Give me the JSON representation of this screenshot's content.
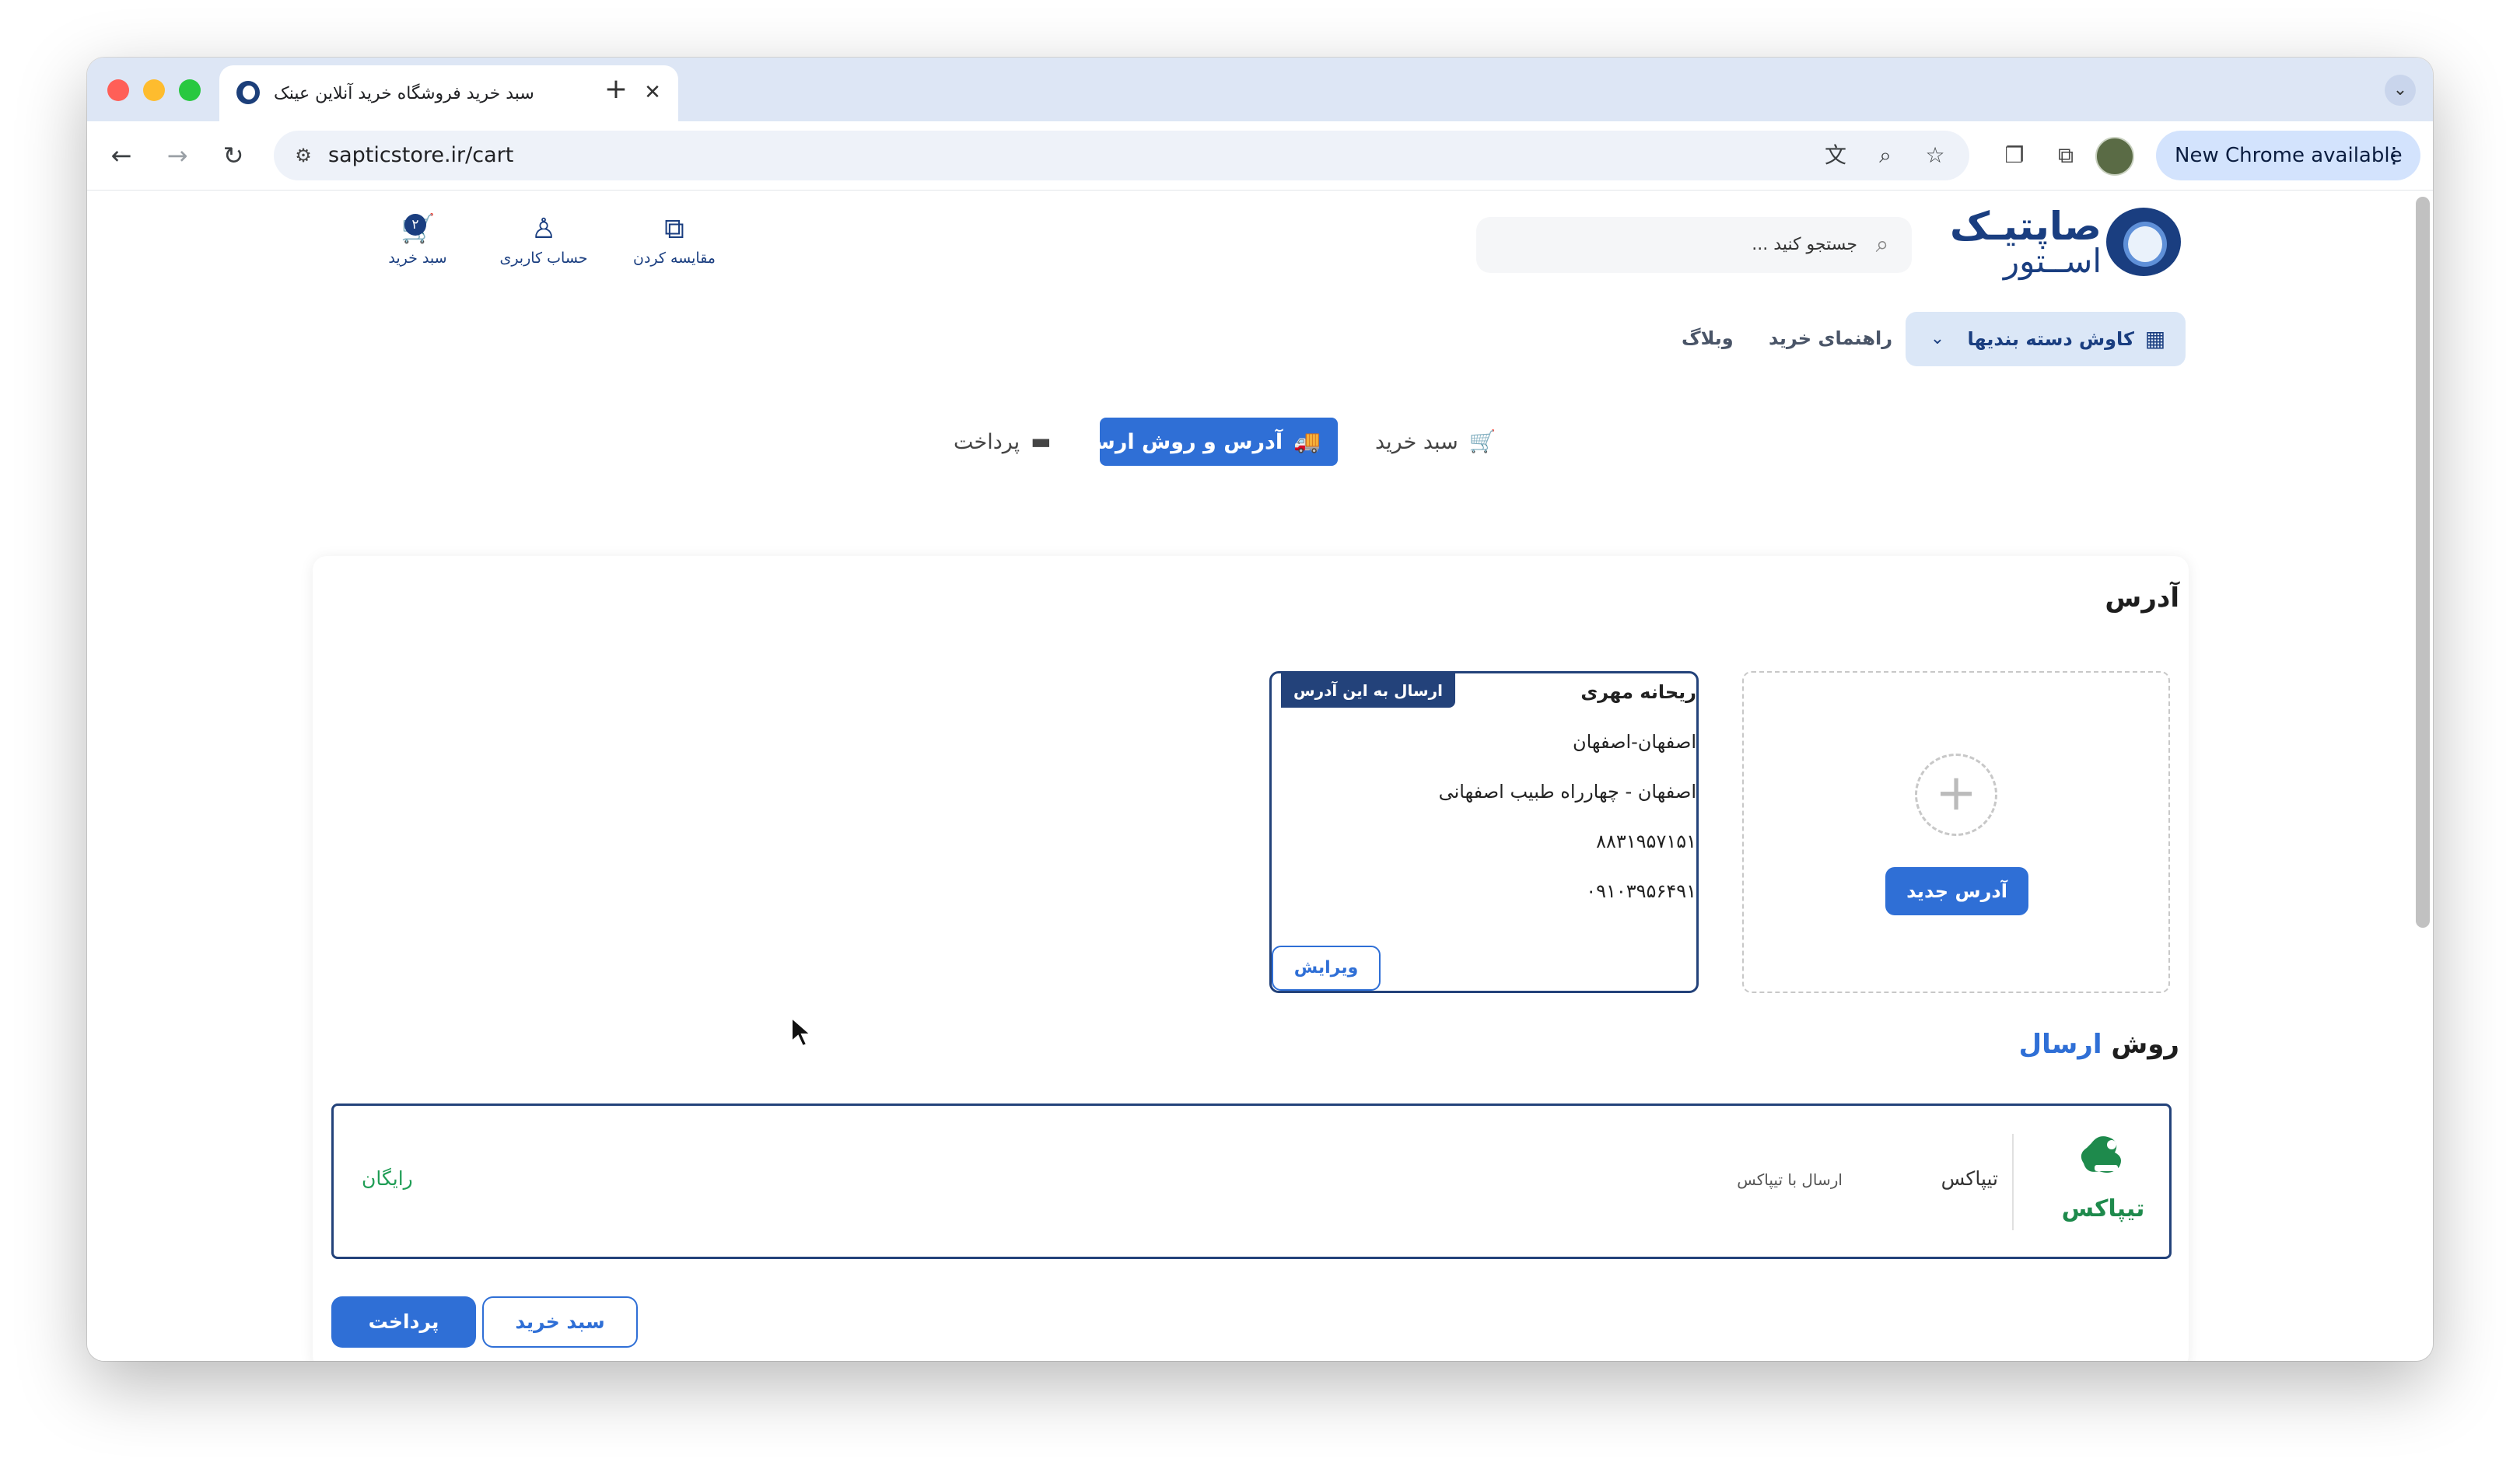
{
  "browser": {
    "tab_title": "سبد خرید فروشگاه خرید آنلاین عینک",
    "url": "sapticstore.ir/cart",
    "chrome_update_label": "New Chrome available",
    "icons": [
      "back-icon",
      "forward-icon",
      "reload-icon",
      "translate-icon",
      "zoom-icon",
      "bookmark-star-icon",
      "tab-group-icon",
      "extensions-icon",
      "kebab-menu-icon"
    ]
  },
  "header": {
    "logo_line1": "صاپتیـک",
    "logo_line2": "اســتور",
    "search_placeholder": "جستجو کنید ...",
    "actions": {
      "compare": "مقایسه کردن",
      "account": "حساب کاربری",
      "cart": "سبد خرید",
      "cart_count": "۲"
    }
  },
  "nav": {
    "categories": "کاوش دسته بندیها",
    "guide": "راهنمای خرید",
    "blog": "وبلاگ"
  },
  "steps": {
    "cart": "سبد خرید",
    "address": "آدرس و روش ارسال",
    "payment": "پرداخت",
    "active": "address"
  },
  "address_section": {
    "title": "آدرس",
    "new_address_button": "آدرس جدید",
    "selected_badge": "ارسال به این آدرس",
    "card": {
      "name": "ریحانه مهری",
      "city": "اصفهان-اصفهان",
      "street": "اصفهان - چهارراه طبیب اصفهانی",
      "postal_code": "۸۸۳۱۹۵۷۱۵۱",
      "phone": "۰۹۱۰۳۹۵۶۴۹۱",
      "edit_label": "ویرایش"
    }
  },
  "shipping_section": {
    "title_part1": "روش",
    "title_part2": "ارسال",
    "method_name": "تیپاکس",
    "method_description": "ارسال با تیپاکس",
    "method_price": "رایگان",
    "logo_text": "تیپاکس"
  },
  "buttons": {
    "pay": "پرداخت",
    "back_to_cart": "سبد خرید"
  },
  "colors": {
    "primary": "#2f6fd6",
    "navy": "#23427a",
    "free_green": "#1f9d55",
    "tipax_green": "#1e8a4c"
  }
}
